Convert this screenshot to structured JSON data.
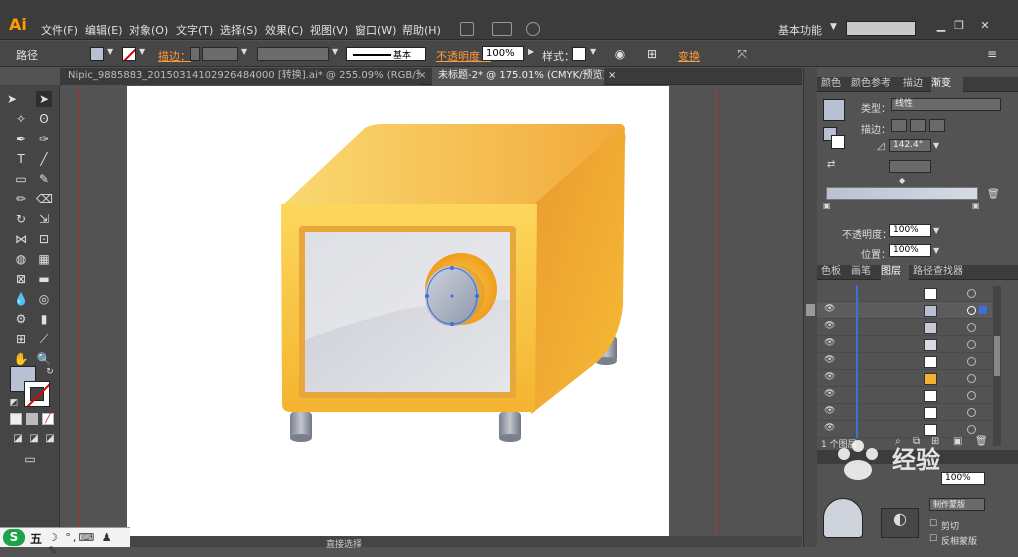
{
  "app": {
    "logo": "Ai"
  },
  "menu": {
    "items": [
      "文件(F)",
      "编辑(E)",
      "对象(O)",
      "文字(T)",
      "选择(S)",
      "效果(C)",
      "视图(V)",
      "窗口(W)",
      "帮助(H)"
    ]
  },
  "workspace": {
    "label": "基本功能"
  },
  "control": {
    "path_label": "路径",
    "stroke_label": "描边：",
    "stroke_profile": "基本",
    "opacity_label": "不透明度：",
    "opacity_value": "100%",
    "style_label": "样式：",
    "transform_label": "变换"
  },
  "tabs": [
    {
      "label": "Nipic_9885883_20150314102926484000 [转换].ai* @ 255.09% (RGB/预览)"
    },
    {
      "label": "未标题-2* @ 175.01% (CMYK/预览)"
    }
  ],
  "status": {
    "text": "直接选择"
  },
  "gradient_panel": {
    "tabs": [
      "颜色",
      "颜色参考",
      "描边",
      "渐变"
    ],
    "type_label": "类型：",
    "type_value": "线性",
    "stroke_label": "描边：",
    "angle_value": "142.4°",
    "opacity_label": "不透明度：",
    "opacity_value": "100%",
    "position_label": "位置：",
    "position_value": "100%"
  },
  "layers_panel": {
    "tabs": [
      "色板",
      "画笔",
      "图层",
      "路径查找器"
    ],
    "count_label": "1 个图层",
    "row_count": 9
  },
  "lower_panel": {
    "clip_label": "剪切",
    "invert_label": "反相蒙版",
    "btn_label": "制作蒙版"
  },
  "watermark": {
    "text": "经验"
  },
  "taskbar": {
    "text": "五"
  },
  "colors": {
    "accent": "#ff9a00",
    "link": "#ff9a3c",
    "safe_orange": "#f7b932",
    "safe_silver": "#d9dbe1"
  }
}
